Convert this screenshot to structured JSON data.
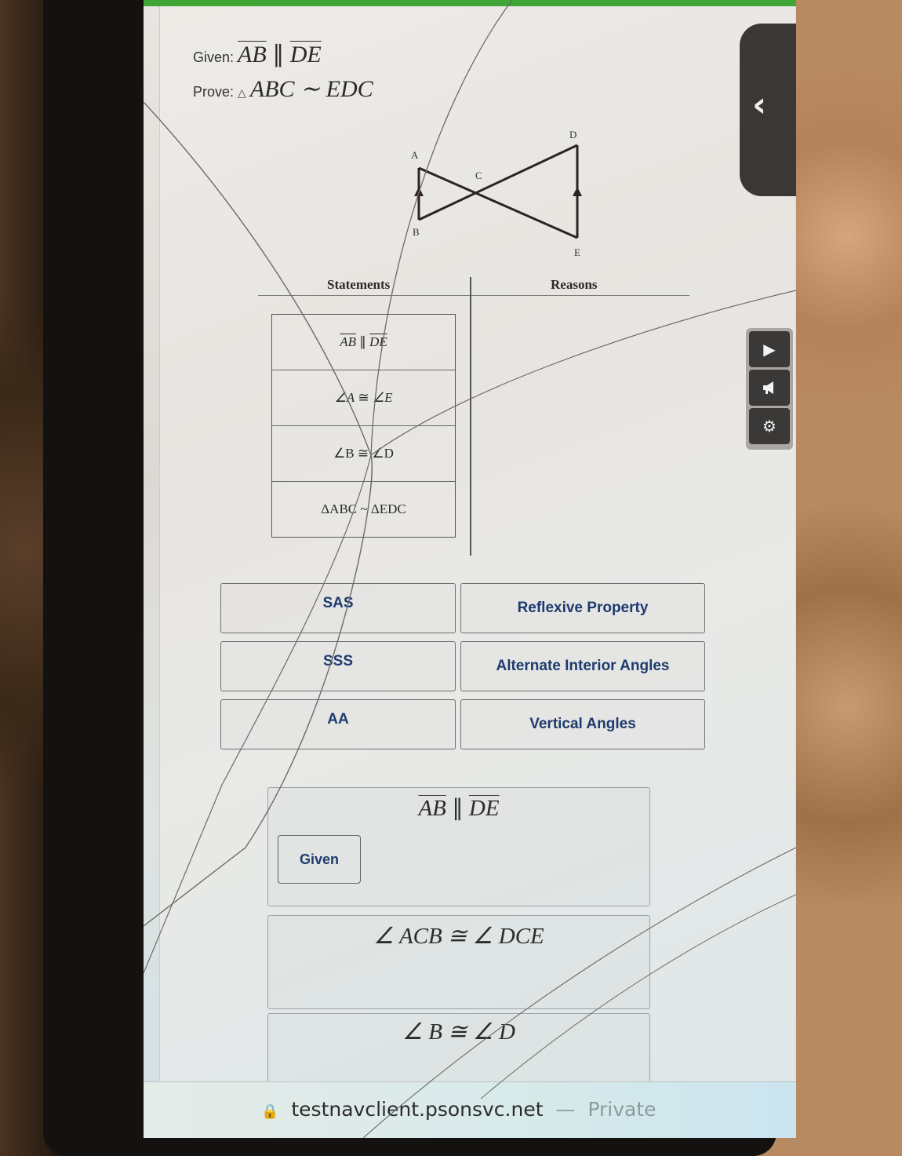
{
  "problem": {
    "given_label": "Given:",
    "given_seg1": "AB",
    "given_parallel": " ∥ ",
    "given_seg2": "DE",
    "prove_label": "Prove:",
    "prove_triangle": "△",
    "prove_statement": "ABC ∼ EDC"
  },
  "diagram": {
    "labels": {
      "A": "A",
      "B": "B",
      "C": "C",
      "D": "D",
      "E": "E"
    },
    "parallel_marks": [
      "AB",
      "DE"
    ]
  },
  "proof_table": {
    "statements_header": "Statements",
    "reasons_header": "Reasons",
    "statements": [
      {
        "left": "AB",
        "op": " ∥ ",
        "right": "DE",
        "overline": true
      },
      {
        "left": "∠A",
        "op": " ≅ ",
        "right": "∠E",
        "overline": false
      },
      {
        "left": "∠B",
        "op": " ≅ ",
        "right": "∠D",
        "overline": false
      },
      {
        "left": "ΔABC",
        "op": " ~ ",
        "right": "ΔEDC",
        "overline": false
      }
    ],
    "reasons": []
  },
  "reason_choices": [
    "SAS",
    "Reflexive Property",
    "SSS",
    "Alternate Interior Angles",
    "AA",
    "Vertical Angles"
  ],
  "answer_area": [
    {
      "statement_seg1": "AB",
      "statement_op": " ∥ ",
      "statement_seg2": "DE",
      "reason": "Given"
    },
    {
      "statement": "∠ ACB ≅ ∠ DCE",
      "reason": ""
    },
    {
      "statement": "∠ B ≅ ∠ D",
      "reason": ""
    }
  ],
  "side_panel": {
    "collapse_icon": "chevron-left-icon",
    "tools": [
      {
        "icon": "play-icon",
        "glyph": "▶"
      },
      {
        "icon": "megaphone-icon",
        "glyph": "📢"
      },
      {
        "icon": "gear-icon",
        "glyph": "⚙"
      }
    ]
  },
  "browser": {
    "url": "testnavclient.psonsvc.net",
    "separator": " — ",
    "mode": "Private"
  },
  "colors": {
    "top_bar": "#3fa535",
    "choice_text": "#1f3b6e",
    "side_tab": "#3a3735"
  }
}
